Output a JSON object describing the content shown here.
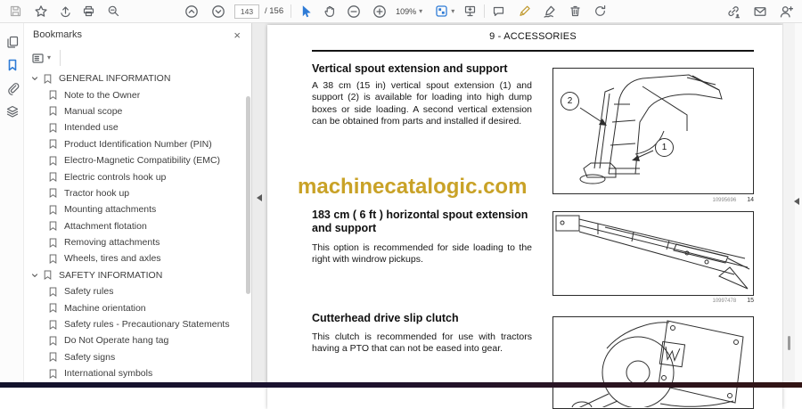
{
  "colors": {
    "accent_blue": "#2e7bd6",
    "watermark_gold": "#c9a227",
    "highlighter_gold": "#c09a30"
  },
  "icons": {
    "caret_down": "▾",
    "close": "×"
  },
  "toolbar": {
    "page_current": "143",
    "page_total": "/ 156",
    "zoom_level": "109%"
  },
  "bookmarks_panel": {
    "title": "Bookmarks",
    "sections": [
      {
        "label": "GENERAL INFORMATION",
        "children": [
          "Note to the Owner",
          "Manual scope",
          "Intended use",
          "Product Identification Number (PIN)",
          "Electro-Magnetic Compatibility (EMC)",
          "Electric controls hook up",
          "Tractor hook up",
          "Mounting attachments",
          "Attachment flotation",
          "Removing attachments",
          "Wheels, tires and axles"
        ]
      },
      {
        "label": "SAFETY INFORMATION",
        "children": [
          "Safety rules",
          "Machine orientation",
          "Safety rules - Precautionary Statements",
          "Do Not Operate hang tag",
          "Safety signs",
          "International symbols"
        ]
      }
    ]
  },
  "document": {
    "page_header": "9 - ACCESSORIES",
    "watermark": "machinecatalogic.com",
    "sections": [
      {
        "heading": "Vertical spout extension and support",
        "body": "A 38 cm (15 in) vertical spout extension (1) and support (2) is available for loading into high dump boxes or side loading. A second vertical extension can be obtained from parts and installed if desired.",
        "figure": {
          "photo_id": "10995696",
          "number": "14",
          "callout_top": "2",
          "callout_bottom": "1"
        }
      },
      {
        "heading": "183 cm ( 6 ft ) horizontal spout extension and support",
        "body": "This option is recommended for side loading to the right with windrow pickups.",
        "figure": {
          "photo_id": "10997478",
          "number": "15"
        }
      },
      {
        "heading": "Cutterhead drive slip clutch",
        "body": "This clutch is recommended for use with tractors having a PTO that can not be eased into gear.",
        "figure": {}
      }
    ]
  }
}
